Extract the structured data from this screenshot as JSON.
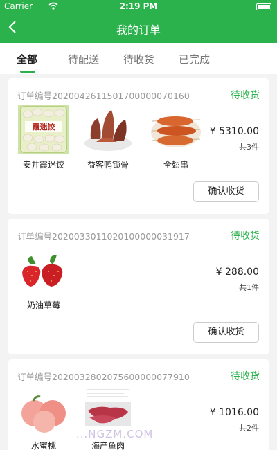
{
  "status_bar": {
    "carrier": "Carrier",
    "time": "2:19 PM"
  },
  "header": {
    "title": "我的订单"
  },
  "tabs": [
    {
      "label": "全部",
      "active": true
    },
    {
      "label": "待配送",
      "active": false
    },
    {
      "label": "待收货",
      "active": false
    },
    {
      "label": "已完成",
      "active": false
    }
  ],
  "orders": [
    {
      "order_no": "订单编号2020042611501700000070160",
      "status": "待收货",
      "products": [
        {
          "name": "安井霞迷饺"
        },
        {
          "name": "益客鸭锁骨"
        },
        {
          "name": "全翅串"
        }
      ],
      "price": "¥ 5310.00",
      "qty": "共3件",
      "action": "确认收货"
    },
    {
      "order_no": "订单编号2020033011020100000031917",
      "status": "待收货",
      "products": [
        {
          "name": "奶油草莓"
        }
      ],
      "price": "¥ 288.00",
      "qty": "共1件",
      "action": "确认收货"
    },
    {
      "order_no": "订单编号2020032802075600000077910",
      "status": "待收货",
      "products": [
        {
          "name": "水蜜桃"
        },
        {
          "name": "海产鱼肉"
        }
      ],
      "price": "¥ 1016.00",
      "qty": "共2件"
    }
  ],
  "product_image_text": "霞迷饺",
  "watermark": "...NGZM.COM",
  "colors": {
    "accent": "#2bb24c"
  }
}
